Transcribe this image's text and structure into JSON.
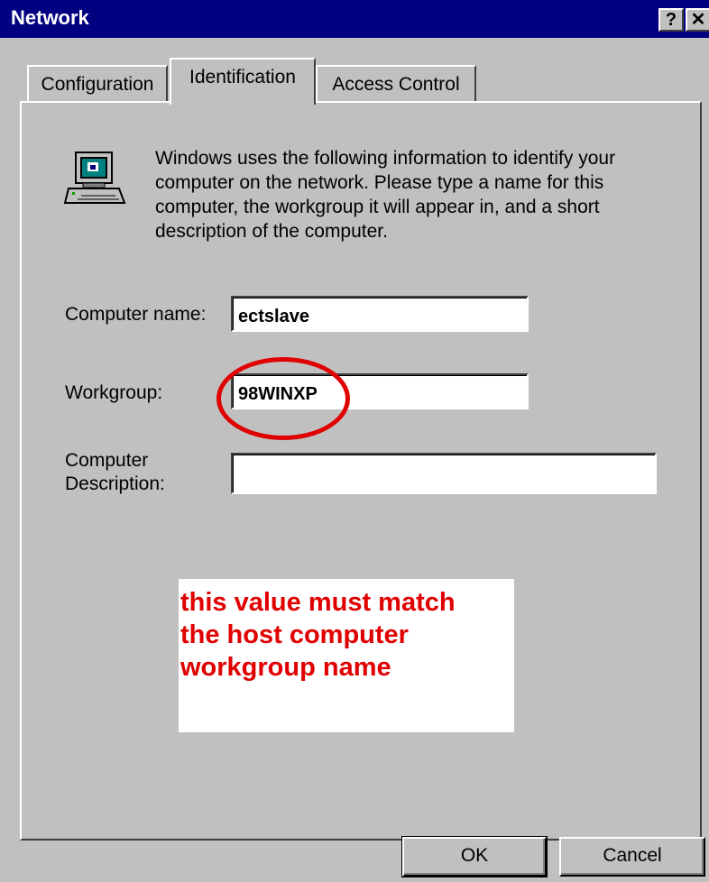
{
  "window": {
    "title": "Network",
    "help_glyph": "?",
    "close_glyph": "✕"
  },
  "tabs": [
    {
      "label": "Configuration"
    },
    {
      "label": "Identification",
      "selected": true
    },
    {
      "label": "Access Control"
    }
  ],
  "info": {
    "icon": "computer-icon",
    "text": "Windows uses the following information to identify your computer on the network.  Please type a name for this computer, the workgroup it will appear in, and a short description of the computer."
  },
  "form": {
    "computer_name_label": "Computer name:",
    "computer_name_value": "ectslave",
    "workgroup_label": "Workgroup:",
    "workgroup_value": "98WINXP",
    "description_label_line1": "Computer",
    "description_label_line2": "Description:",
    "description_value": ""
  },
  "annotation": {
    "line1": "this value must match",
    "line2": "the host computer",
    "line3": "workgroup name",
    "color": "#e00000"
  },
  "buttons": {
    "ok": "OK",
    "cancel": "Cancel"
  }
}
